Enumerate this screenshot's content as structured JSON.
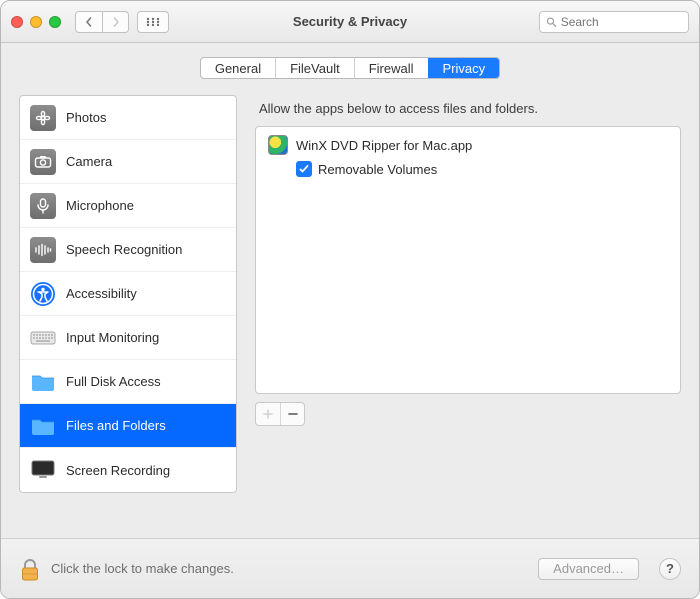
{
  "window": {
    "title": "Security & Privacy"
  },
  "search": {
    "placeholder": "Search"
  },
  "tabs": [
    {
      "label": "General",
      "active": false
    },
    {
      "label": "FileVault",
      "active": false
    },
    {
      "label": "Firewall",
      "active": false
    },
    {
      "label": "Privacy",
      "active": true
    }
  ],
  "sidebar": {
    "items": [
      {
        "label": "Photos"
      },
      {
        "label": "Camera"
      },
      {
        "label": "Microphone"
      },
      {
        "label": "Speech Recognition"
      },
      {
        "label": "Accessibility"
      },
      {
        "label": "Input Monitoring"
      },
      {
        "label": "Full Disk Access"
      },
      {
        "label": "Files and Folders"
      },
      {
        "label": "Screen Recording"
      }
    ],
    "selected_index": 7
  },
  "panel": {
    "hint": "Allow the apps below to access files and folders.",
    "apps": [
      {
        "name": "WinX DVD Ripper for Mac.app",
        "permissions": [
          {
            "label": "Removable Volumes",
            "checked": true
          }
        ]
      }
    ],
    "plus_enabled": false,
    "minus_enabled": true
  },
  "footer": {
    "lock_message": "Click the lock to make changes.",
    "advanced_label": "Advanced…",
    "help_label": "?"
  }
}
